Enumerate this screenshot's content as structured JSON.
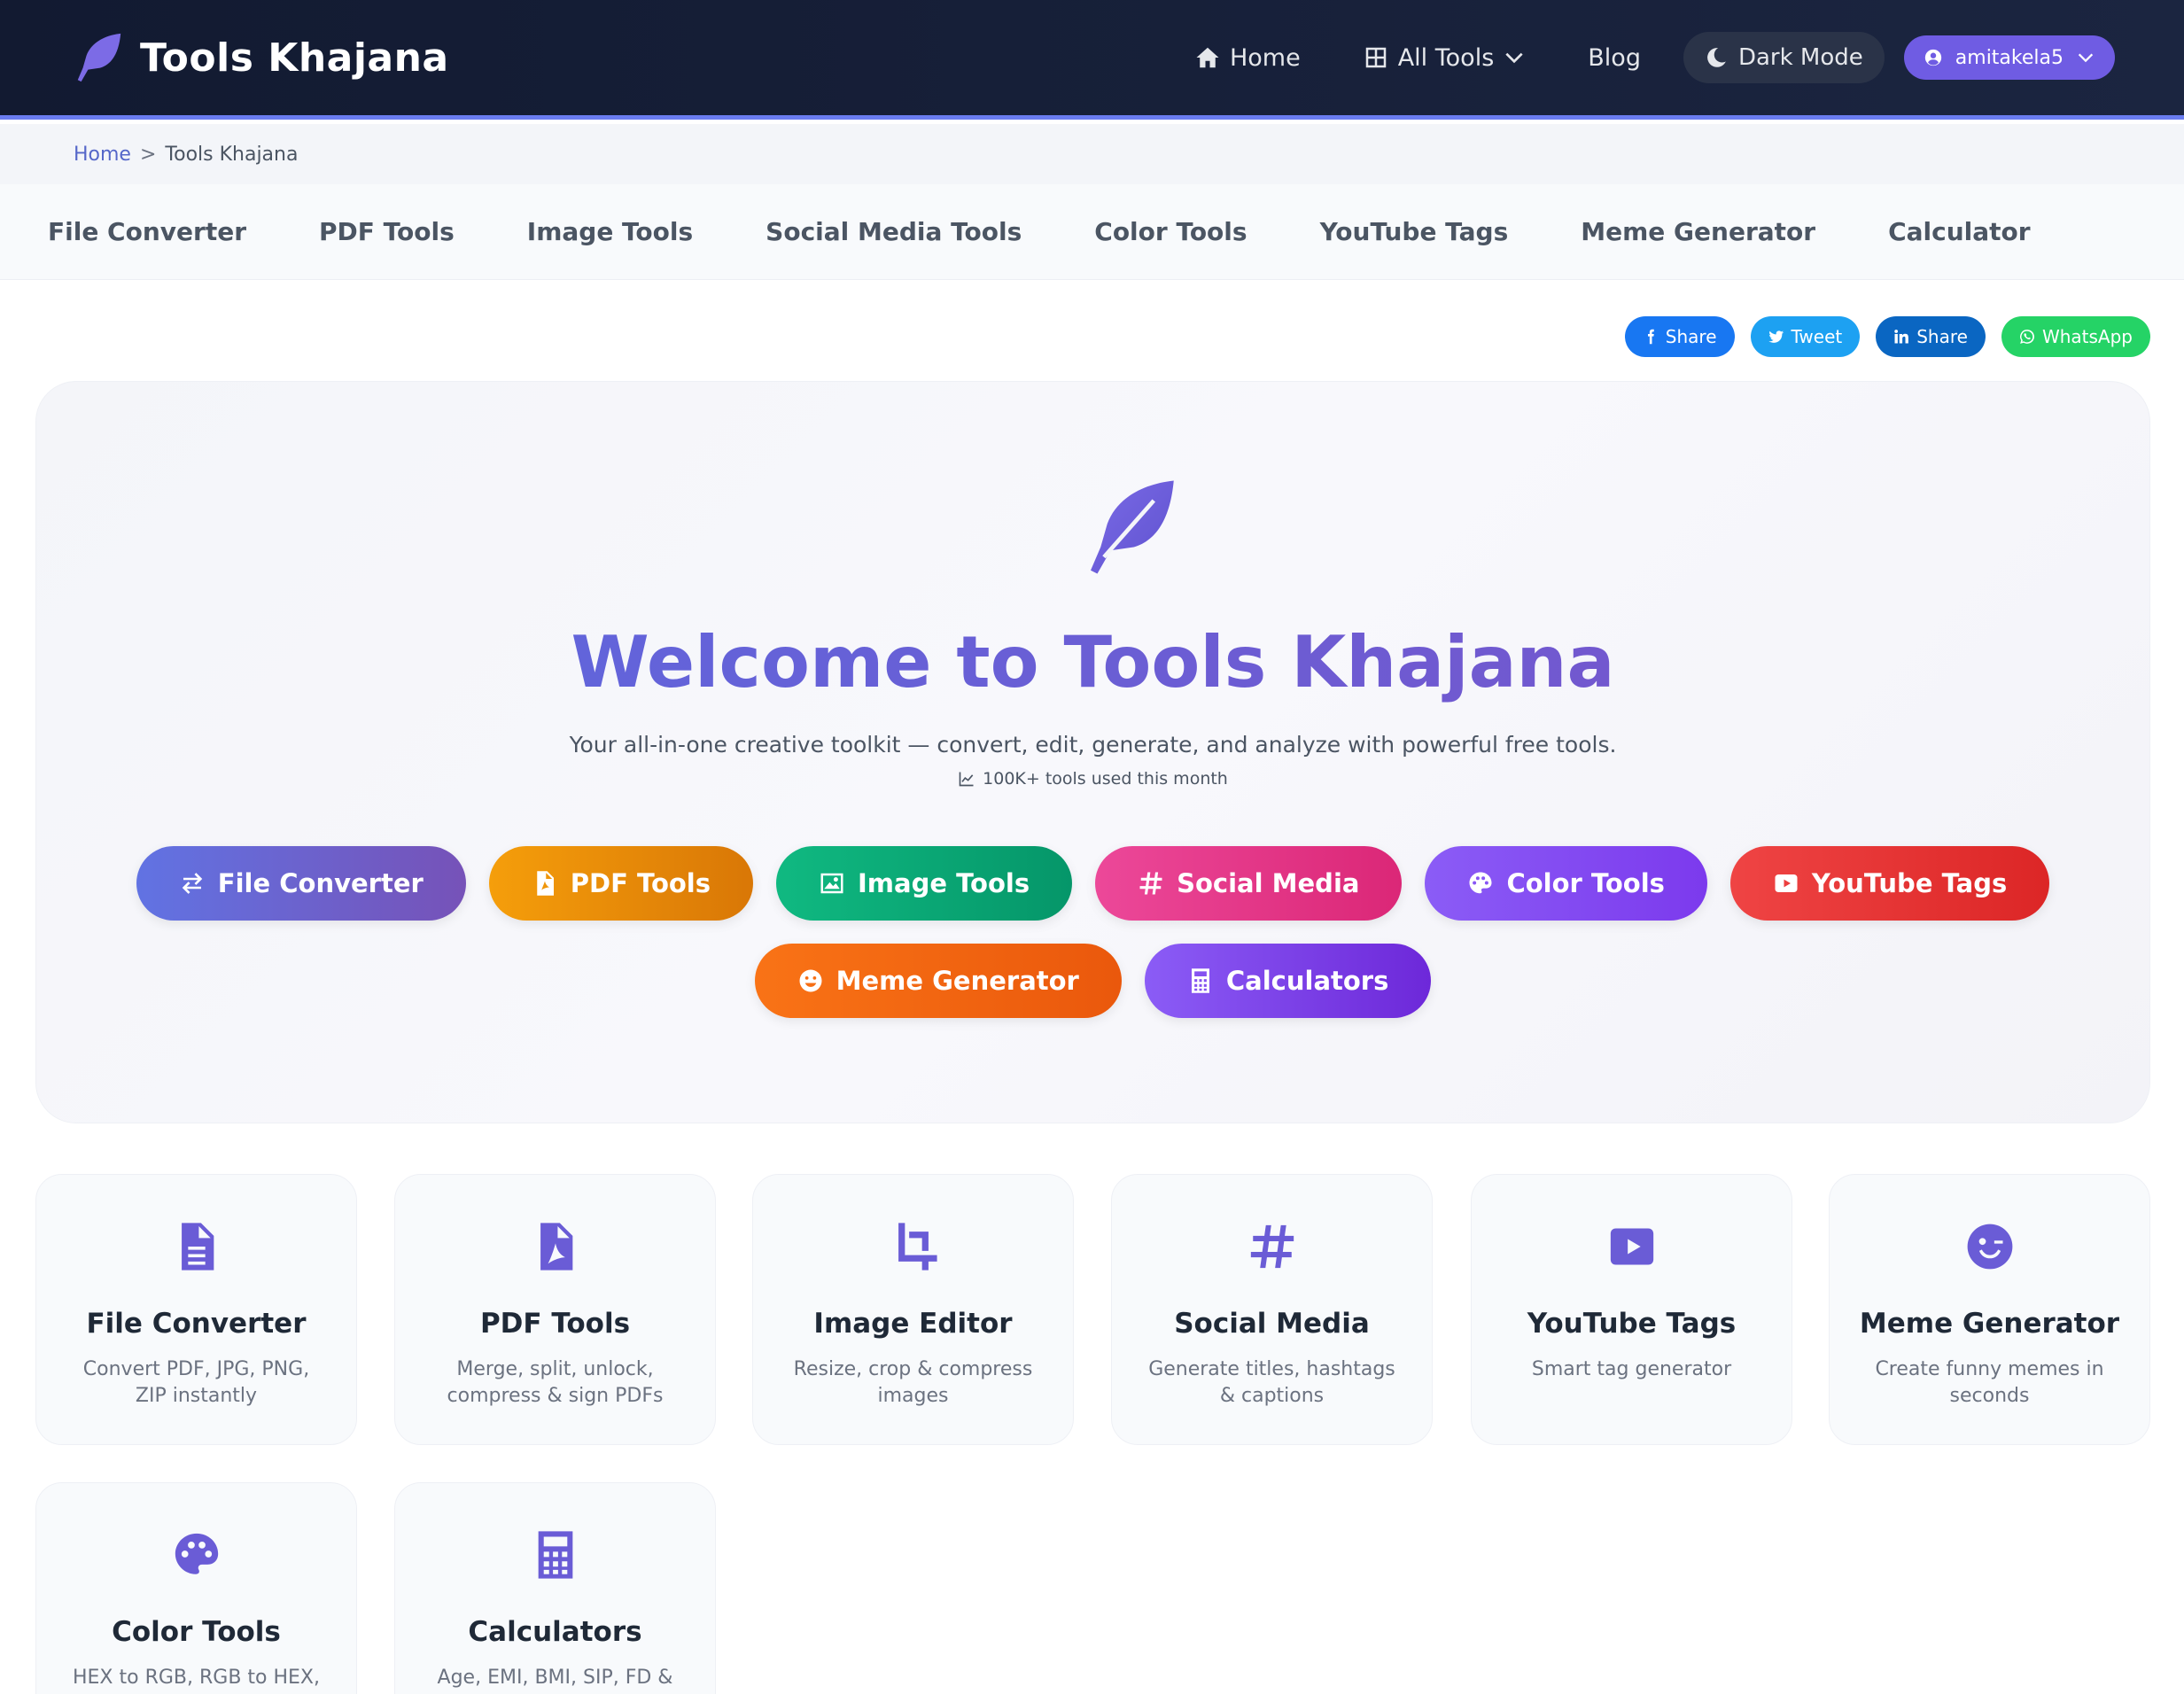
{
  "header": {
    "brand": "Tools Khajana",
    "nav": {
      "home": "Home",
      "all_tools": "All Tools",
      "blog": "Blog",
      "dark_mode": "Dark Mode",
      "user": "amitakela5"
    }
  },
  "breadcrumb": {
    "home": "Home",
    "sep": ">",
    "current": "Tools Khajana"
  },
  "categories": [
    "File Converter",
    "PDF Tools",
    "Image Tools",
    "Social Media Tools",
    "Color Tools",
    "YouTube Tags",
    "Meme Generator",
    "Calculator"
  ],
  "share": {
    "facebook": "Share",
    "twitter": "Tweet",
    "linkedin": "Share",
    "whatsapp": "WhatsApp"
  },
  "hero": {
    "title": "Welcome to Tools Khajana",
    "subtitle": "Your all-in-one creative toolkit — convert, edit, generate, and analyze with powerful free tools.",
    "stat": "100K+ tools used this month",
    "buttons": [
      "File Converter",
      "PDF Tools",
      "Image Tools",
      "Social Media",
      "Color Tools",
      "YouTube Tags",
      "Meme Generator",
      "Calculators"
    ]
  },
  "cards": [
    {
      "title": "File Converter",
      "desc": "Convert PDF, JPG, PNG, ZIP instantly"
    },
    {
      "title": "PDF Tools",
      "desc": "Merge, split, unlock, compress & sign PDFs"
    },
    {
      "title": "Image Editor",
      "desc": "Resize, crop & compress images"
    },
    {
      "title": "Social Media",
      "desc": "Generate titles, hashtags & captions"
    },
    {
      "title": "YouTube Tags",
      "desc": "Smart tag generator"
    },
    {
      "title": "Meme Generator",
      "desc": "Create funny memes in seconds"
    },
    {
      "title": "Color Tools",
      "desc": "HEX to RGB, RGB to HEX,"
    },
    {
      "title": "Calculators",
      "desc": "Age, EMI, BMI, SIP, FD &"
    }
  ],
  "colors": {
    "header_bg": "#121a31",
    "accent": "#6a5cd6",
    "facebook": "#1877f2",
    "twitter": "#1da1f2",
    "linkedin": "#0a66c2",
    "whatsapp": "#25d366"
  }
}
